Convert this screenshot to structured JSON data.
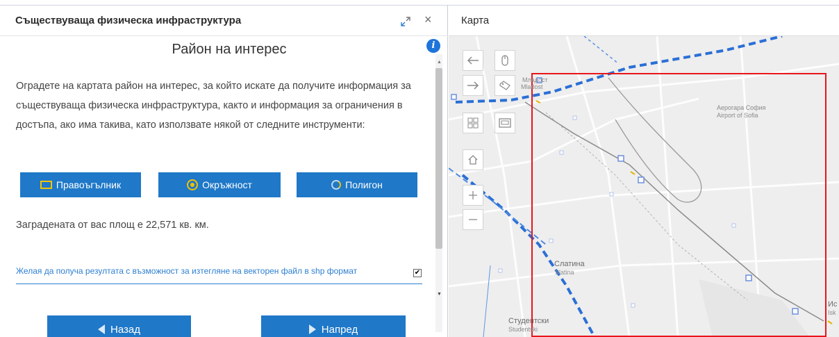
{
  "panel": {
    "title": "Съществуваща физическа инфраструктура",
    "section_title": "Район на интерес",
    "instructions": "Оградете на картата район на интерес, за който искате да получите информация за съществуваща физическа инфраструктура, както и информация за ограничения в достъпа, ако има такива, като използвате някой от следните инструменти:",
    "tools": {
      "rectangle": "Правоъгълник",
      "circle": "Окръжност",
      "polygon": "Полигон"
    },
    "area_text": "Заградената от вас площ е 22,571 кв. км.",
    "shp_option": "Желая да получа резултата с възможност за изтегляне на векторен файл в shp формат",
    "shp_checked": "✔",
    "back_label": "Назад",
    "next_label": "Напред",
    "info_glyph": "i",
    "close_glyph": "×"
  },
  "map": {
    "title": "Карта",
    "labels": {
      "mladost_1": "Младост",
      "mladost_2": "Mladost",
      "airport_1": "Аерогара София",
      "airport_2": "Airport of Sofia",
      "slatina_1": "Слатина",
      "slatina_2": "Slatina",
      "student_1": "Студентски",
      "student_2": "Studentski",
      "edge_1": "Ис",
      "edge_2": "Isk"
    },
    "colors": {
      "selection": "#e8151b",
      "route": "#2a6fd6",
      "accent_button": "#1f78c8"
    }
  }
}
